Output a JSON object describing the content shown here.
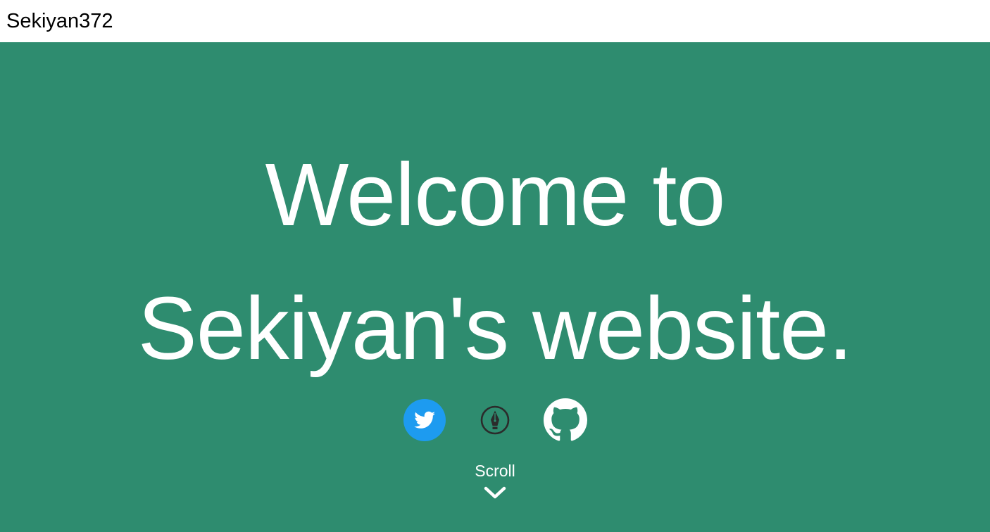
{
  "header": {
    "site_name": "Sekiyan372"
  },
  "hero": {
    "background_color": "#2e8c6f",
    "title_line_1": "Welcome to",
    "title_line_2": "Sekiyan's website.",
    "social_links": [
      {
        "icon": "twitter-bird-icon",
        "color": "#1d9bf0"
      },
      {
        "icon": "fountain-pen-icon",
        "color": "#2b2b2b"
      },
      {
        "icon": "github-octocat-icon",
        "color": "#ffffff"
      }
    ],
    "scroll_label": "Scroll",
    "scroll_icon": "chevron-down-icon"
  }
}
